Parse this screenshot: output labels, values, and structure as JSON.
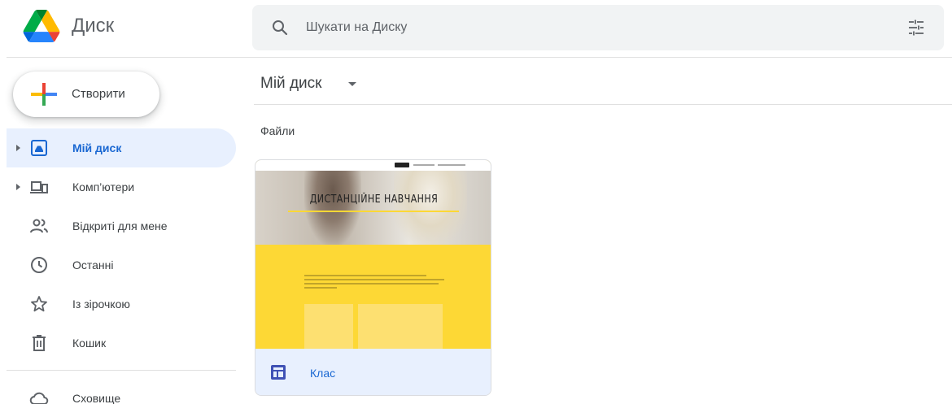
{
  "app": {
    "brand": "Диск"
  },
  "search": {
    "placeholder": "Шукати на Диску"
  },
  "create_button": {
    "label": "Створити"
  },
  "sidebar": {
    "items": [
      {
        "label": "Мій диск",
        "icon": "my-drive-icon",
        "active": true,
        "expandable": true
      },
      {
        "label": "Комп’ютери",
        "icon": "computers-icon",
        "active": false,
        "expandable": true
      },
      {
        "label": "Відкриті для мене",
        "icon": "shared-with-me-icon",
        "active": false
      },
      {
        "label": "Останні",
        "icon": "clock-icon",
        "active": false
      },
      {
        "label": "Із зірочкою",
        "icon": "star-icon",
        "active": false
      },
      {
        "label": "Кошик",
        "icon": "trash-icon",
        "active": false
      },
      {
        "label": "Сховище",
        "icon": "cloud-icon",
        "active": false
      }
    ]
  },
  "main": {
    "breadcrumb": "Мій диск",
    "section_title": "Файли",
    "files": [
      {
        "name": "Клас",
        "type_icon": "google-sites-icon",
        "thumbnail": {
          "headline": "ДИСТАНЦІЙНЕ НАВЧАННЯ",
          "accent_color": "#fdd835"
        }
      }
    ]
  },
  "colors": {
    "active_bg": "#e8f0fe",
    "active_text": "#1967d2",
    "search_bg": "#f1f3f4"
  }
}
